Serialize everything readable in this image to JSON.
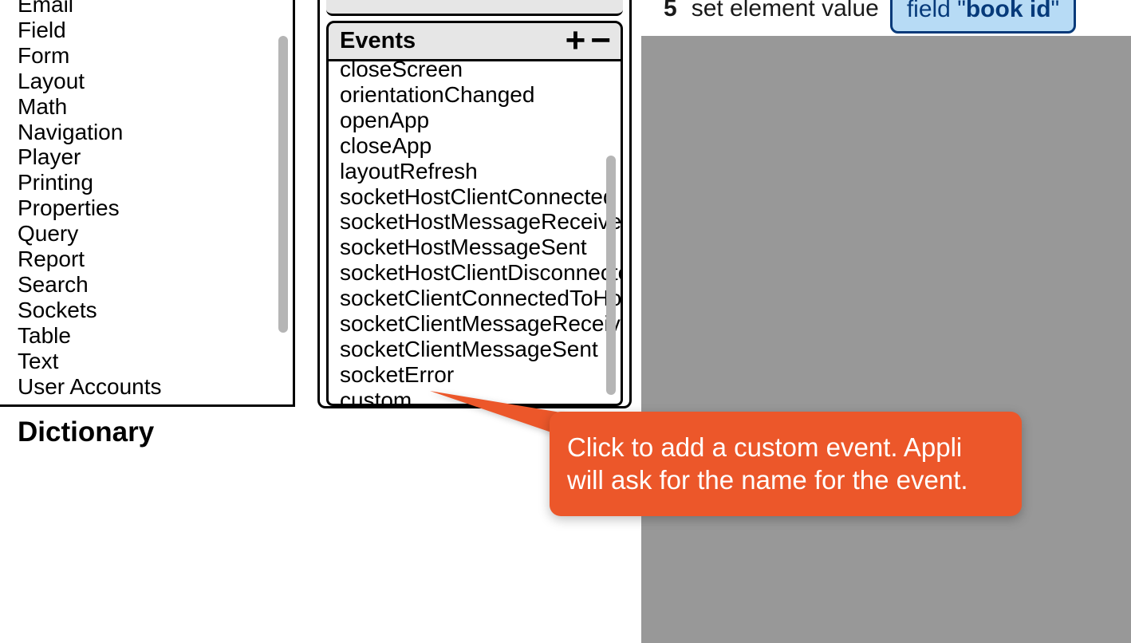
{
  "categories": {
    "items": [
      "Email",
      "Field",
      "Form",
      "Layout",
      "Math",
      "Navigation",
      "Player",
      "Printing",
      "Properties",
      "Query",
      "Report",
      "Search",
      "Sockets",
      "Table",
      "Text",
      "User Accounts"
    ],
    "footer": "Dictionary"
  },
  "events": {
    "header_label": "Events",
    "items": [
      "closeScreen",
      "orientationChanged",
      "openApp",
      "closeApp",
      "layoutRefresh",
      "socketHostClientConnected",
      "socketHostMessageReceived",
      "socketHostMessageSent",
      "socketHostClientDisconnected",
      "socketClientConnectedToHost",
      "socketClientMessageReceived",
      "socketClientMessageSent",
      "socketError",
      "custom"
    ]
  },
  "step": {
    "number": "5",
    "action": "set element value",
    "field_prefix": "field \"",
    "field_name": "book id",
    "field_suffix": "\""
  },
  "callout": {
    "text": "Click to add a custom event. Appli will ask for the name for the event."
  }
}
